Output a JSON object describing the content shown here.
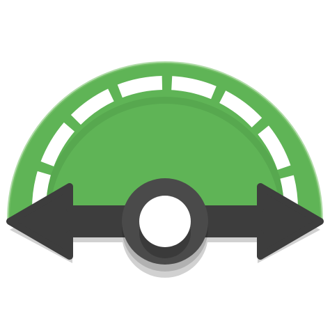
{
  "icon": {
    "name": "speedometer-scale-app-icon",
    "colors": {
      "dial_green": "#5fb456",
      "dial_highlight": "#7dc46f",
      "segment_white": "#ffffff",
      "arrow_dark": "#3d3d3d",
      "hub_ring": "#4a4a4a",
      "hub_center": "#ffffff",
      "shadow": "#000000"
    }
  }
}
